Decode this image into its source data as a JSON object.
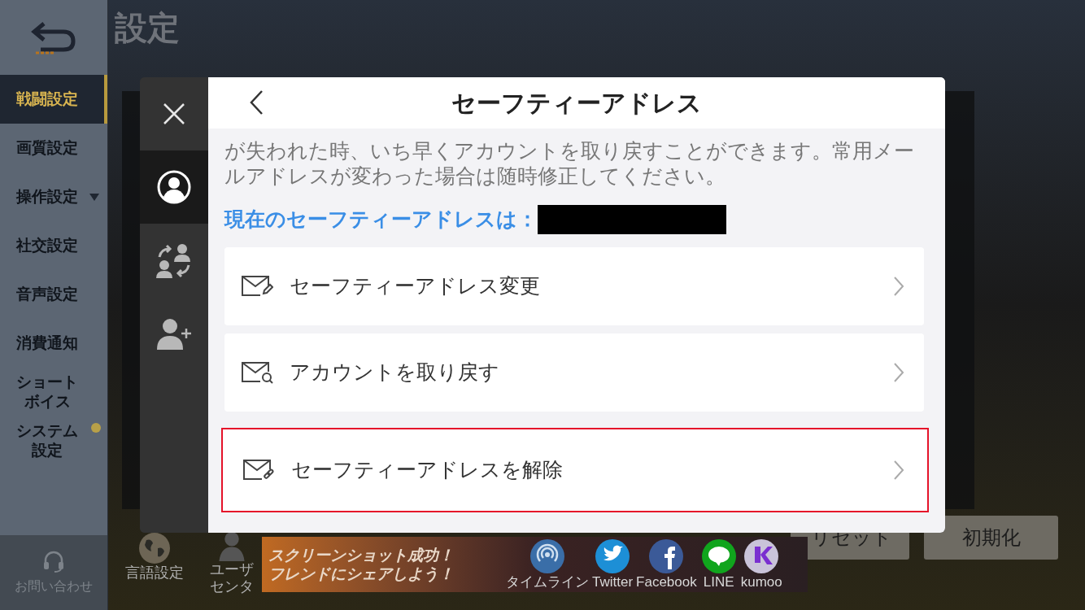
{
  "page_title": "設定",
  "sidebar": {
    "items": [
      {
        "label": "戦闘設定",
        "selected": true,
        "kind": "plain",
        "notice": false
      },
      {
        "label": "画質設定",
        "selected": false,
        "kind": "plain",
        "notice": false
      },
      {
        "label": "操作設定",
        "selected": false,
        "kind": "dropdown",
        "notice": false
      },
      {
        "label": "社交設定",
        "selected": false,
        "kind": "plain",
        "notice": false
      },
      {
        "label": "音声設定",
        "selected": false,
        "kind": "plain",
        "notice": false
      },
      {
        "label": "消費通知",
        "selected": false,
        "kind": "plain",
        "notice": false
      },
      {
        "label": "ショートボイス",
        "selected": false,
        "kind": "plain",
        "notice": false
      },
      {
        "label": "システム設定",
        "selected": false,
        "kind": "plain",
        "notice": true
      }
    ],
    "help_label": "お問い合わせ"
  },
  "bottom_links": [
    {
      "label": "言語設定",
      "kind": "globe"
    },
    {
      "label": "ユーザセンタ",
      "kind": "user"
    }
  ],
  "buttons": [
    "リセット",
    "初期化"
  ],
  "modal": {
    "tabs": [
      {
        "kind": "profile",
        "selected": true
      },
      {
        "kind": "switch",
        "selected": false
      },
      {
        "kind": "add",
        "selected": false
      }
    ],
    "title": "セーフティーアドレス",
    "intro": "が失われた時、いち早くアカウントを取り戻すことができます。常用メールアドレスが変わった場合は随時修正してください。",
    "current_label": "現在のセーフティーアドレスは：",
    "address_redacted": true,
    "options": [
      {
        "label": "セーフティーアドレス変更",
        "kind": "edit",
        "highlighted": false
      },
      {
        "label": "アカウントを取り戻す",
        "kind": "search",
        "highlighted": false
      },
      {
        "label": "セーフティーアドレスを解除",
        "kind": "link",
        "highlighted": true
      }
    ]
  },
  "share": {
    "message": "スクリーンショット成功！フレンドにシェアしよう！",
    "targets": [
      {
        "label": "タイムライン",
        "kind": "timeline",
        "color": "#3a6ea8"
      },
      {
        "label": "Twitter",
        "kind": "bird",
        "color": "#1d8fd6"
      },
      {
        "label": "Facebook",
        "kind": "f",
        "color": "#3b5a98"
      },
      {
        "label": "LINE",
        "kind": "bubble",
        "color": "#10a51d"
      },
      {
        "label": "kumoo",
        "kind": "k",
        "color": "#c9c3d9"
      }
    ]
  }
}
